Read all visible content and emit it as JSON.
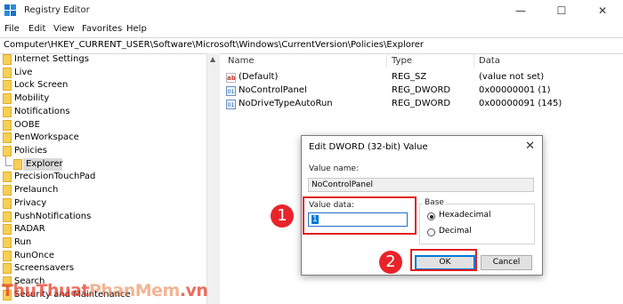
{
  "window": {
    "title": "Registry Editor",
    "minimize": "—",
    "maximize": "☐",
    "close": "✕"
  },
  "menu": [
    "File",
    "Edit",
    "View",
    "Favorites",
    "Help"
  ],
  "address": "Computer\\HKEY_CURRENT_USER\\Software\\Microsoft\\Windows\\CurrentVersion\\Policies\\Explorer",
  "tree": {
    "items": [
      {
        "label": "Internet Settings"
      },
      {
        "label": "Live"
      },
      {
        "label": "Lock Screen"
      },
      {
        "label": "Mobility"
      },
      {
        "label": "Notifications"
      },
      {
        "label": "OOBE"
      },
      {
        "label": "PenWorkspace"
      },
      {
        "label": "Policies"
      },
      {
        "label": "Explorer",
        "selected": true,
        "child": true
      },
      {
        "label": "PrecisionTouchPad"
      },
      {
        "label": "Prelaunch"
      },
      {
        "label": "Privacy"
      },
      {
        "label": "PushNotifications"
      },
      {
        "label": "RADAR"
      },
      {
        "label": "Run"
      },
      {
        "label": "RunOnce"
      },
      {
        "label": "Screensavers"
      },
      {
        "label": "Search"
      },
      {
        "label": "Security and Maintenance"
      }
    ]
  },
  "list": {
    "columns": [
      "Name",
      "Type",
      "Data"
    ],
    "rows": [
      {
        "icon": "string-value-icon",
        "name": "(Default)",
        "type": "REG_SZ",
        "data": "(value not set)"
      },
      {
        "icon": "dword-value-icon",
        "name": "NoControlPanel",
        "type": "REG_DWORD",
        "data": "0x00000001 (1)"
      },
      {
        "icon": "dword-value-icon",
        "name": "NoDriveTypeAutoRun",
        "type": "REG_DWORD",
        "data": "0x00000091 (145)"
      }
    ]
  },
  "dialog": {
    "title": "Edit DWORD (32-bit) Value",
    "value_name_label": "Value name:",
    "value_name": "NoControlPanel",
    "value_data_label": "Value data:",
    "value_data": "1",
    "base_label": "Base",
    "base_options": [
      {
        "label": "Hexadecimal",
        "checked": true
      },
      {
        "label": "Decimal",
        "checked": false
      }
    ],
    "ok": "OK",
    "cancel": "Cancel"
  },
  "annotations": {
    "step1": "1",
    "step2": "2",
    "highlight_color": "#e02020"
  },
  "watermark": {
    "part1": "ThuThuat",
    "part2": "PhanMem",
    "part3": ".vn"
  },
  "icons": {
    "app": "registry-editor-icon",
    "folder": "folder-icon"
  }
}
